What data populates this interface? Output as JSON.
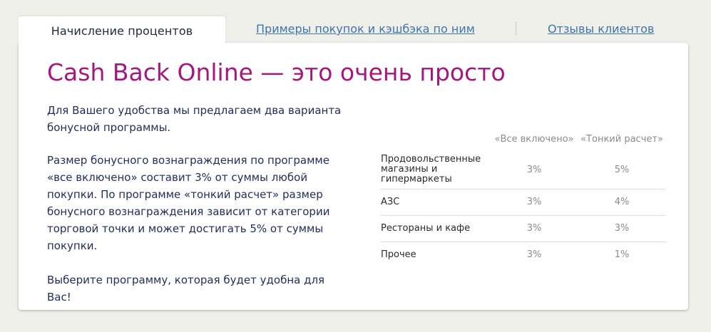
{
  "tabs": {
    "active": "Начисление процентов",
    "examples": "Примеры покупок и кэшбэка по ним",
    "reviews": "Отзывы клиентов"
  },
  "main": {
    "title": "Cash Back Online — это очень просто",
    "intro": "Для Вашего удобства мы предлагаем два варианта бонусной программы.",
    "description": "Размер бонусного вознаграждения по программе «все включено» составит 3% от суммы любой покупки. По программе «тонкий расчет» размер бонусного вознаграждения зависит от категории торговой точки и может достигать 5% от суммы покупки.",
    "cta": "Выберите программу, которая будет удобна для Вас!"
  },
  "table": {
    "headers": [
      "«Все включено»",
      "«Тонкий расчет»"
    ],
    "rows": [
      {
        "category": "Продовольственные магазины и гипермаркеты",
        "all_included": "3%",
        "fine_calc": "5%"
      },
      {
        "category": "АЗС",
        "all_included": "3%",
        "fine_calc": "4%"
      },
      {
        "category": "Рестораны и кафе",
        "all_included": "3%",
        "fine_calc": "3%"
      },
      {
        "category": "Прочее",
        "all_included": "3%",
        "fine_calc": "1%"
      }
    ]
  },
  "colors": {
    "title": "#a3177f",
    "link": "#3f74ad",
    "body_text": "#1f2d58",
    "muted": "#8b8b8b",
    "background": "#efefea"
  }
}
